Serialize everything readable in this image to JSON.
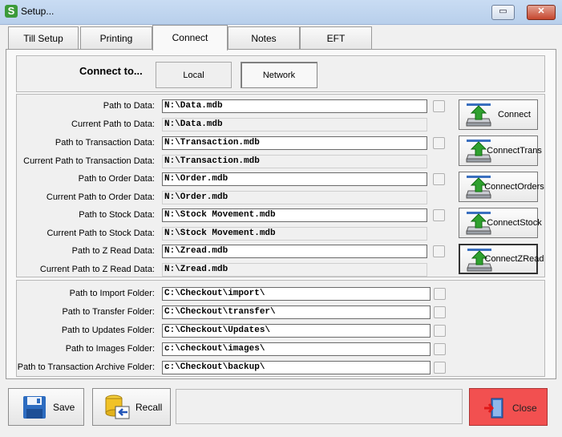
{
  "window": {
    "title": "Setup...",
    "restore_glyph": "▭",
    "close_glyph": "✕",
    "icon": "gear-icon"
  },
  "tabs": [
    {
      "label": "Till Setup",
      "active": false
    },
    {
      "label": "Printing",
      "active": false
    },
    {
      "label": "Connect",
      "active": true
    },
    {
      "label": "Notes",
      "active": false
    },
    {
      "label": "EFT",
      "active": false
    }
  ],
  "connect_to": {
    "label": "Connect to...",
    "local": "Local",
    "network": "Network",
    "selected": "Network"
  },
  "db_rows": [
    {
      "label": "Path to Data:",
      "value": "N:\\Data.mdb",
      "current_label": "Current Path to Data:",
      "current_value": "N:\\Data.mdb"
    },
    {
      "label": "Path to Transaction Data:",
      "value": "N:\\Transaction.mdb",
      "current_label": "Current Path to Transaction Data:",
      "current_value": "N:\\Transaction.mdb"
    },
    {
      "label": "Path to Order Data:",
      "value": "N:\\Order.mdb",
      "current_label": "Current Path to Order Data:",
      "current_value": "N:\\Order.mdb"
    },
    {
      "label": "Path to Stock Data:",
      "value": "N:\\Stock Movement.mdb",
      "current_label": "Current Path to Stock Data:",
      "current_value": "N:\\Stock Movement.mdb"
    },
    {
      "label": "Path to Z Read Data:",
      "value": "N:\\Zread.mdb",
      "current_label": "Current Path to Z Read Data:",
      "current_value": "N:\\Zread.mdb"
    }
  ],
  "connect_buttons": [
    {
      "line1": "Connect",
      "line2": ""
    },
    {
      "line1": "Connect",
      "line2": "Trans"
    },
    {
      "line1": "Connect",
      "line2": "Orders"
    },
    {
      "line1": "Connect",
      "line2": "Stock"
    },
    {
      "line1": "Connect",
      "line2": "ZRead"
    }
  ],
  "folder_rows": [
    {
      "label": "Path to Import Folder:",
      "value": "C:\\Checkout\\import\\"
    },
    {
      "label": "Path to Transfer Folder:",
      "value": "C:\\Checkout\\transfer\\"
    },
    {
      "label": "Path to Updates Folder:",
      "value": "C:\\Checkout\\Updates\\"
    },
    {
      "label": "Path to Images Folder:",
      "value": "c:\\checkout\\images\\"
    },
    {
      "label": "Path to Transaction Archive Folder:",
      "value": "c:\\Checkout\\backup\\"
    }
  ],
  "footer": {
    "save": "Save",
    "recall": "Recall",
    "close": "Close",
    "status": ""
  },
  "colors": {
    "close_bg": "#f25050",
    "title_bg": "#c9dcf3",
    "connect_arrow": "#2fa12f"
  }
}
